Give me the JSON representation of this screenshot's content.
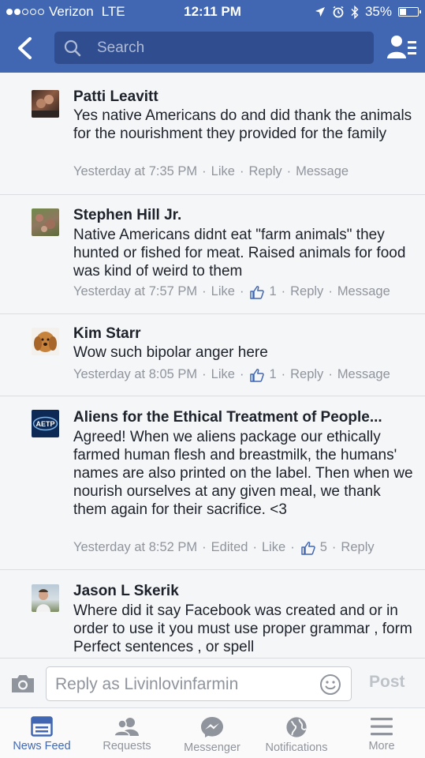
{
  "status_bar": {
    "carrier": "Verizon",
    "network": "LTE",
    "time": "12:11 PM",
    "battery": "35%"
  },
  "nav": {
    "search_placeholder": "Search"
  },
  "comments": [
    {
      "name": "Patti Leavitt",
      "text": "Yes native Americans do and did thank the animals for the nourishment they provided for the family",
      "time": "Yesterday at 7:35 PM",
      "actions": [
        "Like",
        "Reply",
        "Message"
      ]
    },
    {
      "name": "Stephen Hill Jr.",
      "text": "Native Americans didnt eat \"farm animals\" they hunted or fished for meat. Raised animals for food was kind of weird to them",
      "time": "Yesterday at 7:57 PM",
      "like_label": "Like",
      "likes": "1",
      "reply_label": "Reply",
      "message_label": "Message"
    },
    {
      "name": "Kim Starr",
      "text": "Wow such bipolar anger here",
      "time": "Yesterday at 8:05 PM",
      "like_label": "Like",
      "likes": "1",
      "reply_label": "Reply",
      "message_label": "Message"
    },
    {
      "name": "Aliens for the Ethical Treatment of People...",
      "avatar_text": "AETP",
      "text": "Agreed! When we aliens package our ethically farmed human flesh and breastmilk, the humans' names are also printed on the label. Then when we nourish ourselves at any given meal, we thank them again for their sacrifice. <3",
      "time": "Yesterday at 8:52 PM",
      "edited_label": "Edited",
      "like_label": "Like",
      "likes": "5",
      "reply_label": "Reply"
    },
    {
      "name": "Jason L Skerik",
      "text": "Where did it say Facebook was created and or in order to use it you must use proper grammar , form Perfect sentences , or spell"
    }
  ],
  "reply_bar": {
    "placeholder": "Reply as Livinlovinfarmin",
    "post_label": "Post"
  },
  "tabs": [
    {
      "label": "News Feed",
      "icon": "news-feed-icon",
      "active": true
    },
    {
      "label": "Requests",
      "icon": "friend-requests-icon"
    },
    {
      "label": "Messenger",
      "icon": "messenger-icon"
    },
    {
      "label": "Notifications",
      "icon": "globe-icon"
    },
    {
      "label": "More",
      "icon": "hamburger-menu-icon"
    }
  ],
  "colors": {
    "brand_blue": "#4267b2",
    "search_bg": "#2f4d8f",
    "meta_gray": "#90949c"
  }
}
